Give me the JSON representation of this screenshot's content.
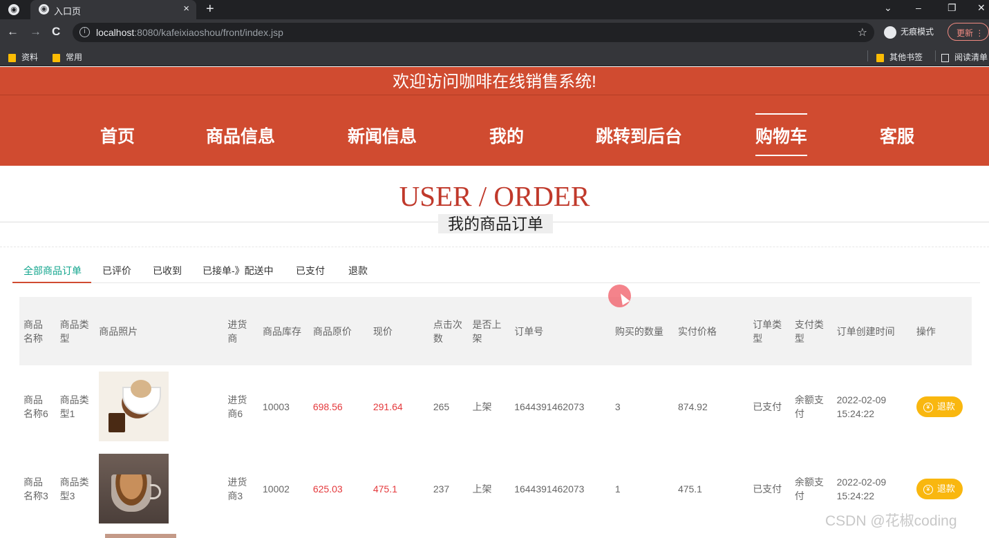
{
  "browser": {
    "tab_title": "入口页",
    "tab_close": "×",
    "new_tab": "+",
    "url_host": "localhost",
    "url_rest": ":8080/kafeixiaoshou/front/index.jsp",
    "incognito_label": "无痕模式",
    "update_label": "更新",
    "bookmarks": [
      "资料",
      "常用"
    ],
    "bookmarks_right": [
      "其他书签",
      "阅读清单"
    ]
  },
  "header": {
    "welcome": "欢迎访问咖啡在线销售系统!",
    "nav": [
      "首页",
      "商品信息",
      "新闻信息",
      "我的",
      "跳转到后台",
      "购物车",
      "客服"
    ],
    "active_nav": "购物车"
  },
  "page": {
    "title_en": "USER / ORDER",
    "title_cn": "我的商品订单"
  },
  "order_tabs": [
    "全部商品订单",
    "已评价",
    "已收到",
    "已接单-》配送中",
    "已支付",
    "退款"
  ],
  "table": {
    "headers": [
      "商品名称",
      "商品类型",
      "商品照片",
      "进货商",
      "商品库存",
      "商品原价",
      "现价",
      "点击次数",
      "是否上架",
      "订单号",
      "购买的数量",
      "实付价格",
      "订单类型",
      "支付类型",
      "订单创建时间",
      "操作"
    ],
    "rows": [
      {
        "name": "商品名称6",
        "type": "商品类型1",
        "photo": "coffee-dessert-photo",
        "supplier": "进货商6",
        "stock": "10003",
        "orig_price": "698.56",
        "price": "291.64",
        "clicks": "265",
        "listed": "上架",
        "order_no": "1644391462073",
        "qty": "3",
        "paid": "874.92",
        "order_type": "已支付",
        "pay_type": "余额支付",
        "created": "2022-02-09 15:24:22",
        "action": "退款"
      },
      {
        "name": "商品名称3",
        "type": "商品类型3",
        "photo": "coffee-cup-photo",
        "supplier": "进货商3",
        "stock": "10002",
        "orig_price": "625.03",
        "price": "475.1",
        "clicks": "237",
        "listed": "上架",
        "order_no": "1644391462073",
        "qty": "1",
        "paid": "475.1",
        "order_type": "已支付",
        "pay_type": "余额支付",
        "created": "2022-02-09 15:24:22",
        "action": "退款"
      }
    ]
  },
  "watermark": "CSDN @花椒coding",
  "colors": {
    "brand": "#d04b30",
    "active_tab": "#12a58d",
    "price_red": "#e4393c",
    "refund": "#f9b70f"
  }
}
